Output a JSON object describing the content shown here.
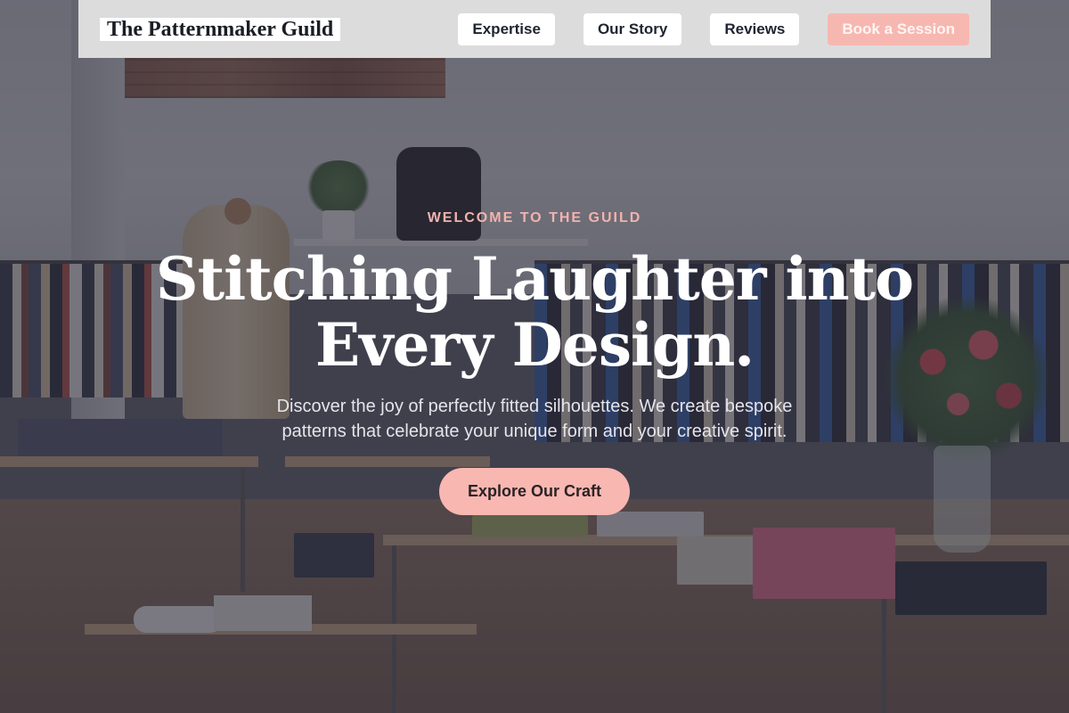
{
  "nav": {
    "brand": "The Patternmaker Guild",
    "links": [
      {
        "label": "Expertise"
      },
      {
        "label": "Our Story"
      },
      {
        "label": "Reviews"
      }
    ],
    "cta_label": "Book a Session"
  },
  "hero": {
    "eyebrow": "WELCOME TO THE GUILD",
    "headline_line1": "Stitching Laughter into",
    "headline_line2": "Every Design.",
    "subtext_line1": "Discover the joy of perfectly fitted silhouettes. We create bespoke",
    "subtext_line2": "patterns that celebrate your unique form and your creative spirit.",
    "button_label": "Explore Our Craft"
  },
  "colors": {
    "accent_pink": "#f7b7b1",
    "overlay": "#302e3e",
    "nav_background": "#dcdcdd"
  }
}
